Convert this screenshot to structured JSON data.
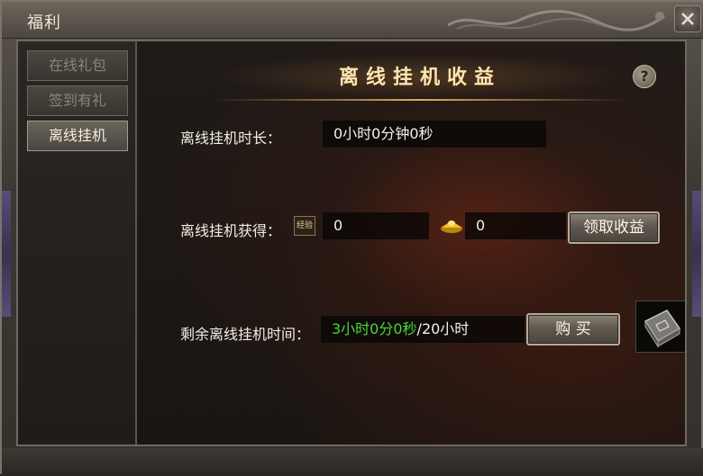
{
  "window": {
    "title": "福利"
  },
  "tabs": [
    {
      "label": "在线礼包",
      "active": false
    },
    {
      "label": "签到有礼",
      "active": false
    },
    {
      "label": "离线挂机",
      "active": true
    }
  ],
  "panel": {
    "heading": "离线挂机收益",
    "help_label": "?",
    "duration_label": "离线挂机时长：",
    "duration_value": "0小时0分钟0秒",
    "earnings_label": "离线挂机获得：",
    "exp_icon_text": "经验",
    "exp_value": "0",
    "gold_value": "0",
    "claim_button": "领取收益",
    "remaining_label": "剩余离线挂机时间：",
    "remaining_value": "3小时0分0秒",
    "remaining_total": "/20小时",
    "buy_button": "购 买"
  },
  "colors": {
    "accent_gold": "#d8b060",
    "remaining_green": "#4cd63a"
  },
  "icons": {
    "close": "close-icon",
    "help": "help-icon",
    "exp": "exp-icon",
    "gold": "gold-ingot-icon",
    "book": "book-icon"
  }
}
